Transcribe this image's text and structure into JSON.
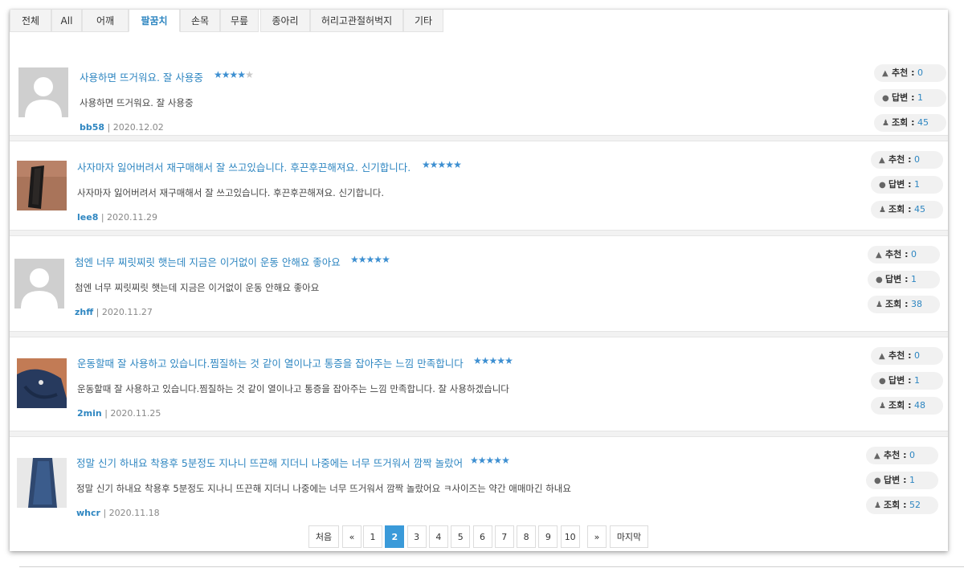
{
  "tabs": [
    {
      "label": "전체"
    },
    {
      "label": "All"
    },
    {
      "label": "어깨"
    },
    {
      "label": "팔꿈치"
    },
    {
      "label": "손목"
    },
    {
      "label": "무릎"
    },
    {
      "label": "종아리"
    },
    {
      "label": "허리고관절허벅지"
    },
    {
      "label": "기타"
    }
  ],
  "active_tab": "팔꿈치",
  "stats_labels": {
    "likes": "추천 :",
    "replies": "답변 :",
    "views": "조회 :"
  },
  "reviews": [
    {
      "title": "사용하면 뜨거워요. 잘 사용중",
      "rating": 4,
      "body": "사용하면 뜨거워요. 잘 사용중",
      "user": "bb58",
      "date": " | 2020.12.02",
      "likes": "0",
      "replies": "1",
      "views": "45",
      "thumb": "placeholder"
    },
    {
      "title": "사자마자 잃어버려서 재구매해서 잘 쓰고있습니다. 후끈후끈해져요. 신기합니다.",
      "rating": 5,
      "body": "사자마자 잃어버려서 재구매해서 잘 쓰고있습니다. 후끈후끈해져요. 신기합니다.",
      "user": "lee8",
      "date": " | 2020.11.29",
      "likes": "0",
      "replies": "1",
      "views": "45",
      "thumb": "photo-brown"
    },
    {
      "title": "첨엔 너무 찌릿찌릿 햇는데 지금은 이거없이 운동 안해요 좋아요",
      "rating": 5,
      "body": "첨엔 너무 찌릿찌릿 햇는데 지금은 이거없이 운동 안해요 좋아요",
      "user": "zhff",
      "date": " | 2020.11.27",
      "likes": "0",
      "replies": "1",
      "views": "38",
      "thumb": "placeholder"
    },
    {
      "title": "운동할때 잘 사용하고 있습니다.찜질하는 것 같이 열이나고 통증을 잡아주는 느낌 만족합니다",
      "rating": 5,
      "body": "운동할때 잘 사용하고 있습니다.찜질하는 것 같이 열이나고 통증을 잡아주는 느낌 만족합니다. 잘 사용하겠습니다",
      "user": "2min",
      "date": " | 2020.11.25",
      "likes": "0",
      "replies": "1",
      "views": "48",
      "thumb": "photo-navy"
    },
    {
      "title": "정말 신기 하내요 착용후 5분정도 지나니 뜨끈해 지더니 나중에는 너무 뜨거워서 깜짝 놀랐어",
      "rating": 5,
      "body": "정말 신기 하내요 착용후 5분정도 지나니 뜨끈해 지더니 나중에는 너무 뜨거워서 깜짝 놀랐어요 ㅋ사이즈는 약간 애매마긴 하내요",
      "user": "whcr",
      "date": " | 2020.11.18",
      "likes": "0",
      "replies": "1",
      "views": "52",
      "thumb": "photo-blue"
    }
  ],
  "pagination": {
    "first": "처음",
    "prev": "«",
    "pages": [
      "1",
      "2",
      "3",
      "4",
      "5",
      "6",
      "7",
      "8",
      "9",
      "10"
    ],
    "current": "2",
    "next": "»",
    "last": "마지막"
  },
  "colors": {
    "accent": "#2e86c1",
    "star": "#3d8fd1",
    "active_page": "#3a9ad9"
  }
}
